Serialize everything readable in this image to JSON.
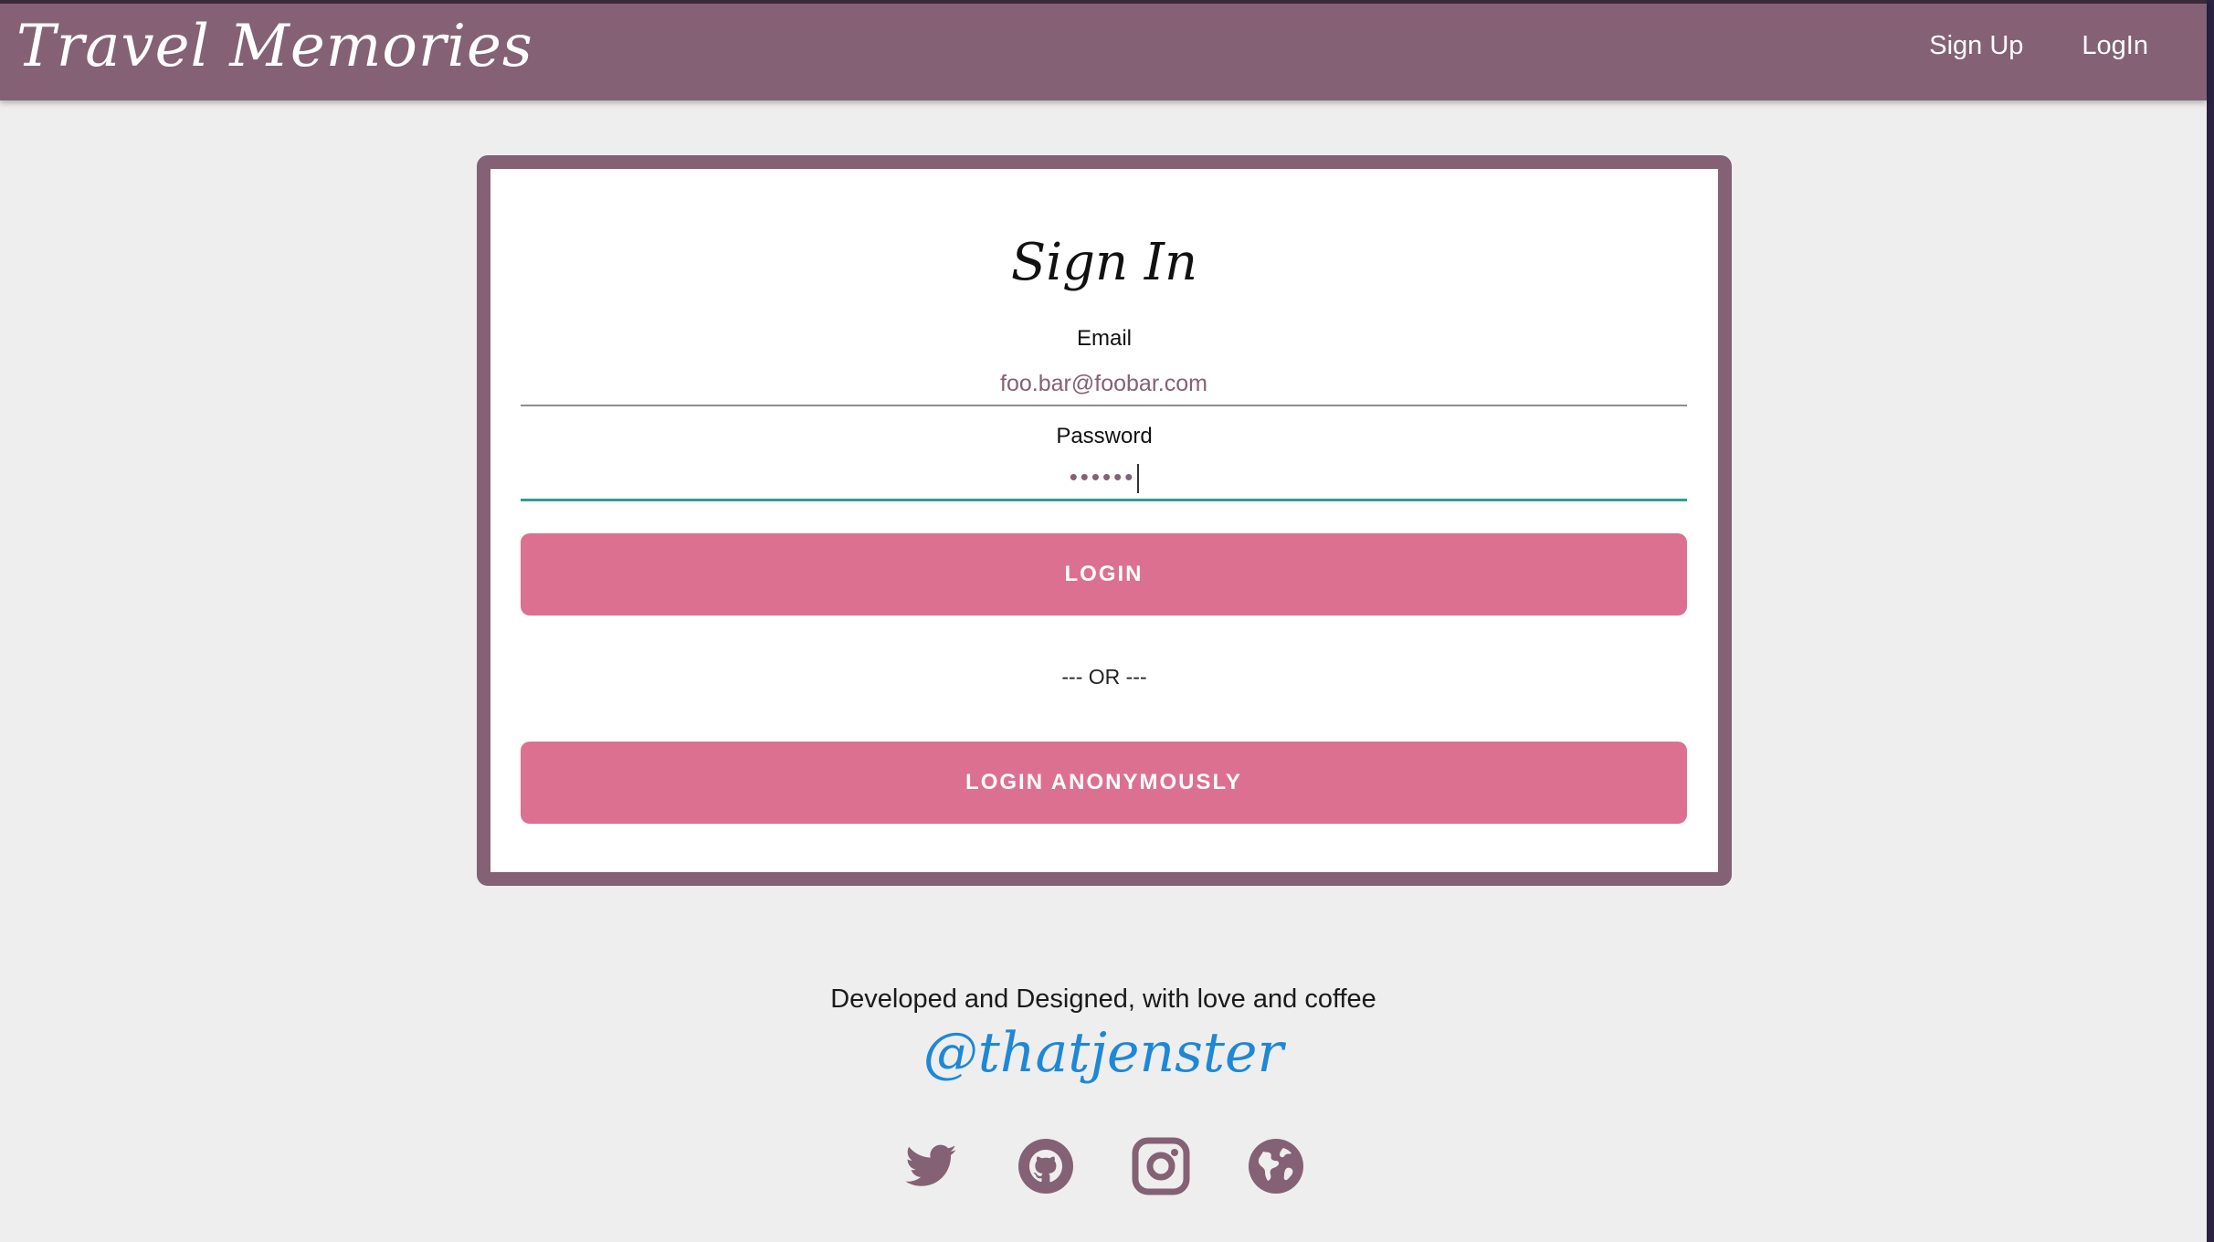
{
  "app": {
    "brand": "Travel Memories",
    "accent_color": "#846174",
    "button_color": "#dc7090"
  },
  "nav": {
    "signup": "Sign Up",
    "login": "LogIn"
  },
  "form": {
    "title": "Sign In",
    "email_label": "Email",
    "email_value": "foo.bar@foobar.com",
    "password_label": "Password",
    "password_masked": "••••••",
    "login_button": "LOGIN",
    "or_text": "--- OR ---",
    "anon_button": "LOGIN ANONYMOUSLY"
  },
  "footer": {
    "credit": "Developed and Designed, with love and coffee",
    "handle": "@thatjenster",
    "socials": [
      "twitter-icon",
      "github-icon",
      "instagram-icon",
      "globe-icon"
    ]
  }
}
